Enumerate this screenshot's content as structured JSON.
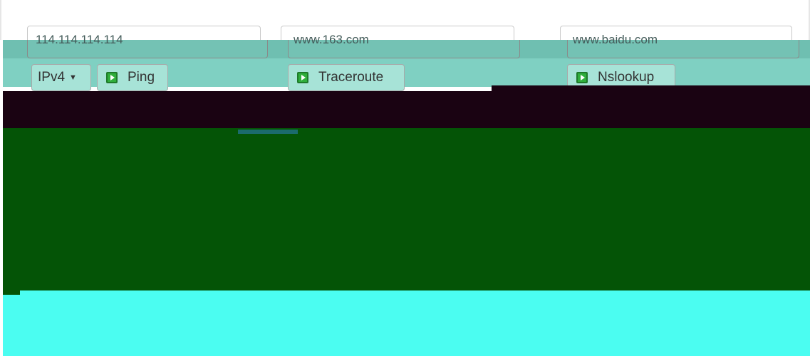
{
  "ping": {
    "input_value": "114.114.114.114",
    "protocol_selected": "IPv4",
    "button_label": "Ping"
  },
  "traceroute": {
    "input_value": "www.163.com",
    "button_label": "Traceroute"
  },
  "nslookup": {
    "input_value": "www.baidu.com",
    "button_label": "Nslookup"
  },
  "icons": {
    "play": "play-icon",
    "dropdown": "chevron-down-icon"
  },
  "colors": {
    "teal_band": "#6fbfb1",
    "button_bg": "#a7e3d7",
    "play_icon": "#2fae3c",
    "output_dark": "#1a0312",
    "output_green": "#045406",
    "output_cyan": "#4bfdf1"
  }
}
